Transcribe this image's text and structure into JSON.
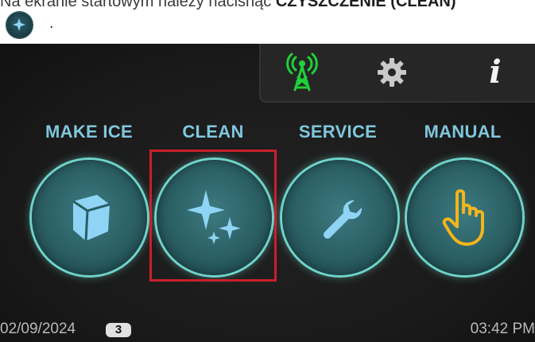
{
  "instruction": {
    "text_prefix": "Na ekranie startowym należy nacisnąć ",
    "text_bold": "CZYSZCZENIE (CLEAN)",
    "text_suffix": ".",
    "icon": "clean-sparkle-icon"
  },
  "status_bar": {
    "icons": [
      "antenna-signal-icon",
      "gear-icon",
      "info-icon"
    ],
    "info_glyph": "i",
    "signal_color": "#1fd13a"
  },
  "menu": {
    "items": [
      {
        "label": "MAKE ICE",
        "icon": "ice-cube-icon"
      },
      {
        "label": "CLEAN",
        "icon": "sparkle-icon",
        "highlighted": true
      },
      {
        "label": "SERVICE",
        "icon": "wrench-icon"
      },
      {
        "label": "MANUAL",
        "icon": "hand-pointer-icon"
      }
    ]
  },
  "footer": {
    "date": "02/09/2024",
    "badge": "3",
    "time": "03:42 PM"
  },
  "colors": {
    "label": "#7fc7dd",
    "button_ring": "#6fd3c9",
    "highlight": "#c8202a",
    "icon_blue": "#8fd4f5",
    "hand": "#f2b51b"
  }
}
